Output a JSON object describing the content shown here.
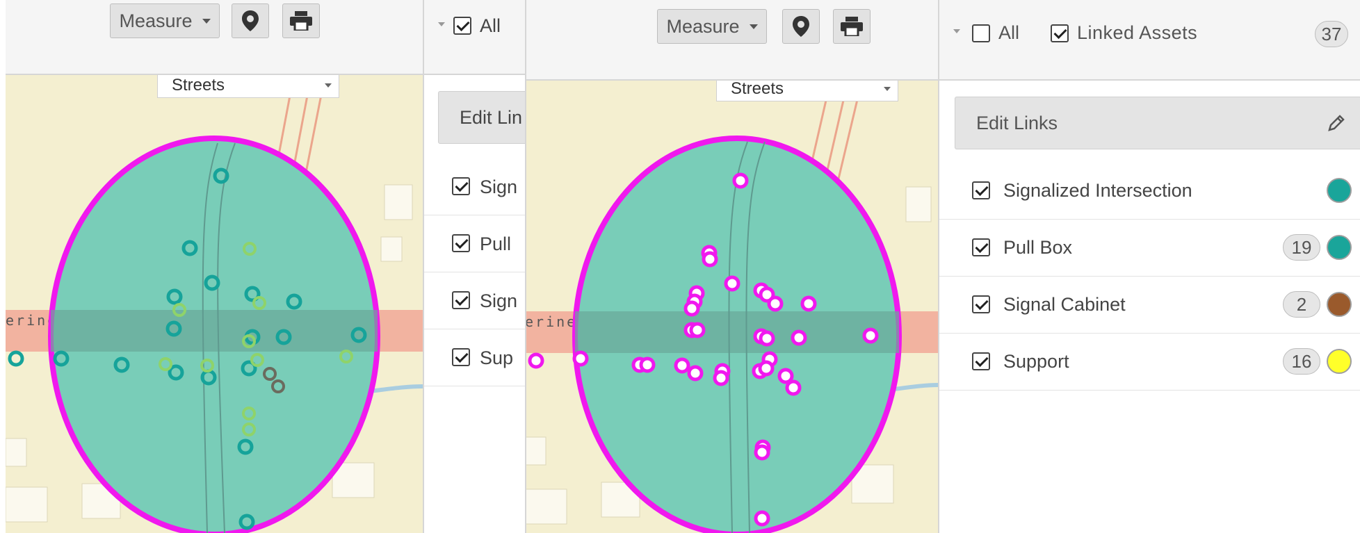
{
  "left_panel": {
    "toolbar": {
      "measure_label": "Measure",
      "all_label": "All",
      "all_checked": true
    },
    "map": {
      "basemap_label": "Streets",
      "road_label": "erine Rd"
    },
    "edit_links_label": "Edit Lin",
    "layers": [
      {
        "label": "Sign",
        "checked": true
      },
      {
        "label": "Pull",
        "checked": true
      },
      {
        "label": "Sign",
        "checked": true
      },
      {
        "label": "Sup",
        "checked": true
      }
    ]
  },
  "right_panel": {
    "toolbar": {
      "measure_label": "Measure",
      "all_label": "All",
      "all_checked": false,
      "linked_label": "Linked Assets",
      "linked_checked": true,
      "linked_count": "37"
    },
    "map": {
      "basemap_label": "Streets",
      "road_label": "erine Rd"
    },
    "edit_links_label": "Edit Links",
    "layers": [
      {
        "label": "Signalized Intersection",
        "checked": true,
        "count": "",
        "color": "#1aa59a"
      },
      {
        "label": "Pull Box",
        "checked": true,
        "count": "19",
        "color": "#1aa59a"
      },
      {
        "label": "Signal Cabinet",
        "checked": true,
        "count": "2",
        "color": "#9a5a2c"
      },
      {
        "label": "Support",
        "checked": true,
        "count": "16",
        "color": "#ffff2a"
      }
    ]
  },
  "icons": {
    "location": "map-marker-icon",
    "print": "printer-icon",
    "edit": "pencil-icon",
    "dropdown": "caret-down-icon"
  },
  "colors": {
    "buffer_fill": "#79cdb8",
    "buffer_stroke": "#f018ee",
    "road": "#f2b3a0",
    "land": "#f4efd0",
    "teal_marker": "#16a39a",
    "highlight": "#f018ee"
  }
}
